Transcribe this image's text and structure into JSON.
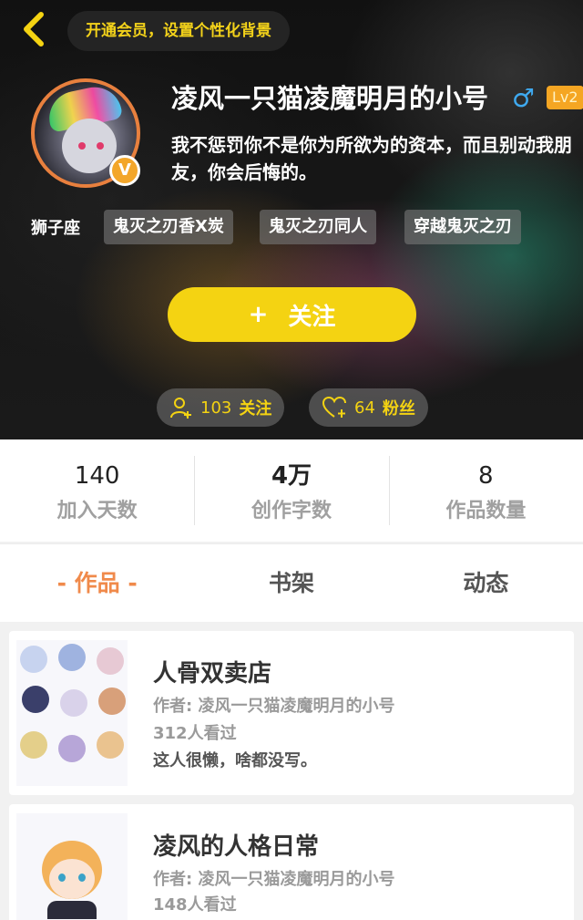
{
  "header": {
    "vip_text": "开通会员，设置个性化背景"
  },
  "profile": {
    "username": "凌风一只猫凌魔明月的小号",
    "gender_icon": "♂",
    "level": "Lv2",
    "verified_badge": "V",
    "bio": "我不惩罚你不是你为所欲为的资本，而且别动我朋友，你会后悔的。",
    "zodiac": "狮子座",
    "tags": [
      "鬼灭之刃香X炭",
      "鬼灭之刃同人",
      "穿越鬼灭之刃"
    ],
    "follow_button": {
      "plus": "+",
      "label": "关注"
    },
    "following": {
      "count": "103",
      "label": "关注"
    },
    "fans": {
      "count": "64",
      "label": "粉丝"
    }
  },
  "stats": [
    {
      "value": "140",
      "label": "加入天数"
    },
    {
      "value": "4万",
      "label": "创作字数"
    },
    {
      "value": "8",
      "label": "作品数量"
    }
  ],
  "tabs": [
    {
      "label": "- 作品 -",
      "active": true
    },
    {
      "label": "书架",
      "active": false
    },
    {
      "label": "动态",
      "active": false
    }
  ],
  "works": [
    {
      "title": "人骨双卖店",
      "author": "作者: 凌风一只猫凌魔明月的小号",
      "views": "312人看过",
      "desc": "这人很懒，啥都没写。"
    },
    {
      "title": "凌风的人格日常",
      "author": "作者: 凌风一只猫凌魔明月的小号",
      "views": "148人看过"
    }
  ],
  "colors": {
    "accent_yellow": "#f4d312",
    "active_tab": "#f08a4b",
    "level_badge": "#f5a623",
    "gender_blue": "#3fa9ef"
  }
}
